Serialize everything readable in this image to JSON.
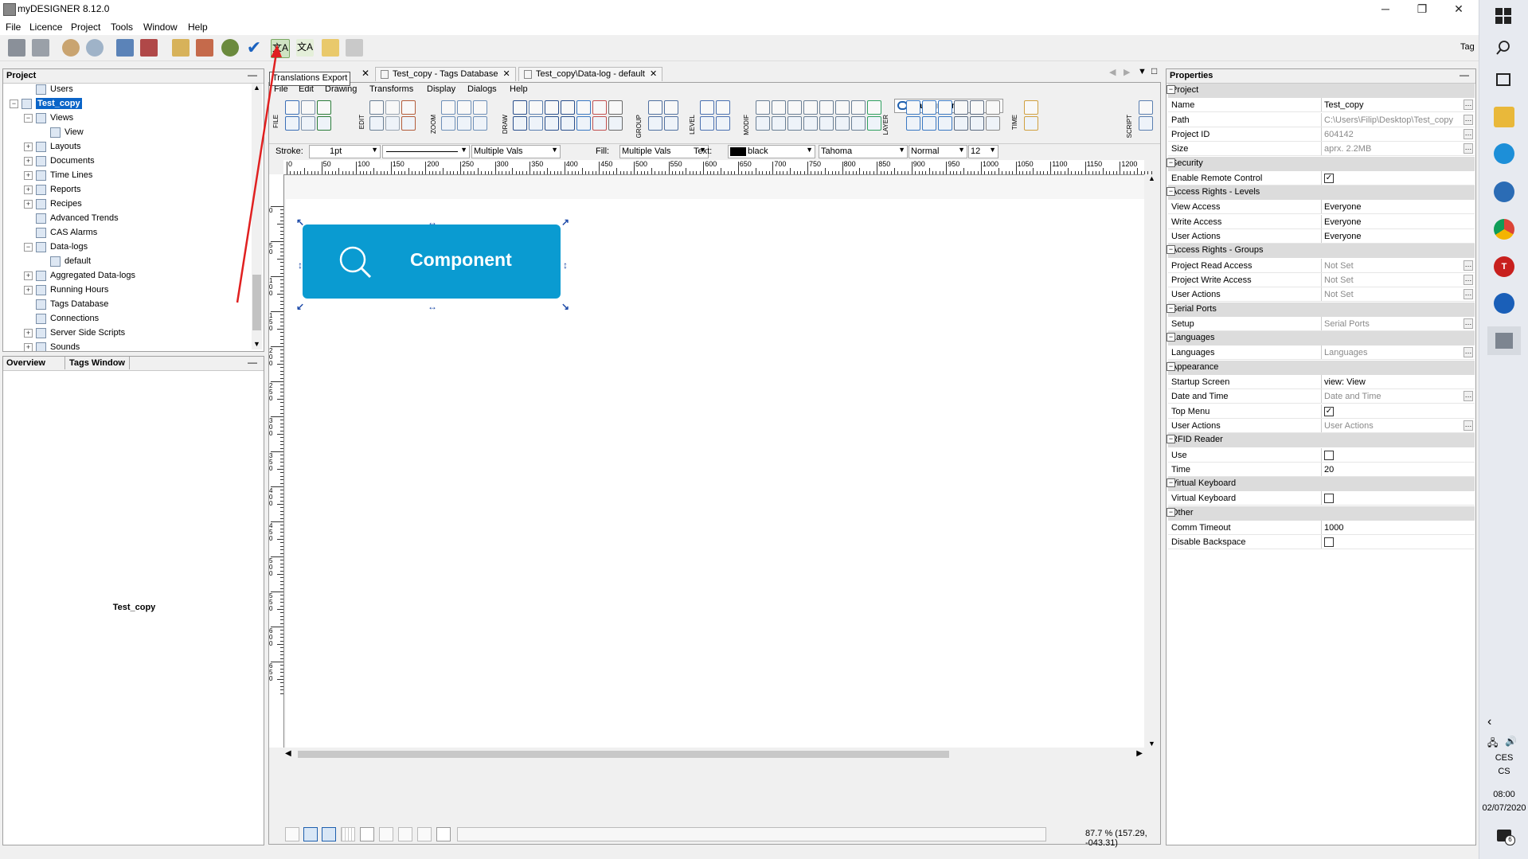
{
  "window": {
    "title": "myDESIGNER 8.12.0",
    "min": "─",
    "max": "❐",
    "close": "✕"
  },
  "menu": [
    "File",
    "Licence",
    "Project",
    "Tools",
    "Window",
    "Help"
  ],
  "toolbar": {
    "tag_label": "Tag",
    "tooltip": "Translations Export"
  },
  "project_panel": {
    "title": "Project",
    "items": [
      {
        "label": "Users",
        "indent": 1,
        "exp": ""
      },
      {
        "label": "Test_copy",
        "indent": 0,
        "exp": "−",
        "selected": true
      },
      {
        "label": "Views",
        "indent": 1,
        "exp": "−"
      },
      {
        "label": "View",
        "indent": 2,
        "exp": ""
      },
      {
        "label": "Layouts",
        "indent": 1,
        "exp": "+"
      },
      {
        "label": "Documents",
        "indent": 1,
        "exp": "+"
      },
      {
        "label": "Time Lines",
        "indent": 1,
        "exp": "+"
      },
      {
        "label": "Reports",
        "indent": 1,
        "exp": "+"
      },
      {
        "label": "Recipes",
        "indent": 1,
        "exp": "+"
      },
      {
        "label": "Advanced Trends",
        "indent": 1,
        "exp": ""
      },
      {
        "label": "CAS Alarms",
        "indent": 1,
        "exp": ""
      },
      {
        "label": "Data-logs",
        "indent": 1,
        "exp": "−"
      },
      {
        "label": "default",
        "indent": 2,
        "exp": ""
      },
      {
        "label": "Aggregated Data-logs",
        "indent": 1,
        "exp": "+"
      },
      {
        "label": "Running Hours",
        "indent": 1,
        "exp": "+"
      },
      {
        "label": "Tags Database",
        "indent": 1,
        "exp": ""
      },
      {
        "label": "Connections",
        "indent": 1,
        "exp": ""
      },
      {
        "label": "Server Side Scripts",
        "indent": 1,
        "exp": "+"
      },
      {
        "label": "Sounds",
        "indent": 1,
        "exp": "+"
      }
    ]
  },
  "overview_panel": {
    "tab1": "Overview",
    "tab2": "Tags Window",
    "center_label": "Test_copy"
  },
  "doc_tabs": [
    {
      "label": "Test_copy - Tags Database"
    },
    {
      "label": "Test_copy\\Data-log - default"
    }
  ],
  "editor_menu": [
    "File",
    "Edit",
    "Drawing",
    "Transforms",
    "Display",
    "Dialogs",
    "Help"
  ],
  "editor_groups": [
    "FILE",
    "EDIT",
    "ZOOM",
    "DRAW",
    "GROUP",
    "LEVEL",
    "MODIF",
    "LAYER",
    "TIME",
    "SCRIPT"
  ],
  "layer": {
    "label": "Background"
  },
  "format_bar": {
    "stroke_label": "Stroke:",
    "stroke_value": "1pt",
    "stroke_style": "Multiple Vals",
    "fill_label": "Fill:",
    "fill_value": "Multiple Vals",
    "text_label": "Text:",
    "text_color": "black",
    "font": "Tahoma",
    "weight": "Normal",
    "size": "12"
  },
  "ruler_labels": [
    "0",
    "50",
    "100",
    "150",
    "200",
    "250",
    "300",
    "350",
    "400",
    "450",
    "500",
    "550",
    "600",
    "650",
    "700",
    "750",
    "800",
    "850",
    "900",
    "950",
    "1000",
    "1050",
    "1100",
    "1150",
    "1200"
  ],
  "vruler_labels": [
    "0",
    "50",
    "100",
    "150",
    "200",
    "250",
    "300",
    "350",
    "400",
    "450",
    "500",
    "550",
    "600",
    "650"
  ],
  "canvas": {
    "component_label": "Component",
    "component_color": "#0a9bd1"
  },
  "status": {
    "zoom": "87.7 % (157.29, -043.31)"
  },
  "properties": {
    "title": "Properties",
    "rows": [
      {
        "cat": "Project"
      },
      {
        "name": "Name",
        "value": "Test_copy",
        "btn": true
      },
      {
        "name": "Path",
        "value": "C:\\Users\\Filip\\Desktop\\Test_copy",
        "gray": true,
        "btn": true
      },
      {
        "name": "Project ID",
        "value": "604142",
        "gray": true,
        "btn": true
      },
      {
        "name": "Size",
        "value": "aprx. 2.2MB",
        "gray": true,
        "btn": true
      },
      {
        "cat": "Security"
      },
      {
        "name": "Enable Remote Control",
        "check": true
      },
      {
        "cat": "Access Rights - Levels"
      },
      {
        "name": "View Access",
        "value": "Everyone"
      },
      {
        "name": "Write Access",
        "value": "Everyone"
      },
      {
        "name": "User Actions",
        "value": "Everyone"
      },
      {
        "cat": "Access Rights - Groups"
      },
      {
        "name": "Project Read Access",
        "value": "Not Set",
        "gray": true,
        "btn": true
      },
      {
        "name": "Project Write Access",
        "value": "Not Set",
        "gray": true,
        "btn": true
      },
      {
        "name": "User Actions",
        "value": "Not Set",
        "gray": true,
        "btn": true
      },
      {
        "cat": "Serial Ports"
      },
      {
        "name": "Setup",
        "value": "Serial Ports",
        "gray": true,
        "btn": true
      },
      {
        "cat": "Languages"
      },
      {
        "name": "Languages",
        "value": "Languages",
        "gray": true,
        "btn": true
      },
      {
        "cat": "Appearance"
      },
      {
        "name": "Startup Screen",
        "value": "view: View"
      },
      {
        "name": "Date and Time",
        "value": "Date and Time",
        "gray": true,
        "btn": true
      },
      {
        "name": "Top Menu",
        "check": true
      },
      {
        "name": "User Actions",
        "value": "User Actions",
        "gray": true,
        "btn": true
      },
      {
        "cat": "RFID Reader"
      },
      {
        "name": "Use",
        "check": false
      },
      {
        "name": "Time",
        "value": "20"
      },
      {
        "cat": "Virtual Keyboard"
      },
      {
        "name": "Virtual Keyboard",
        "check": false
      },
      {
        "cat": "Other"
      },
      {
        "name": "Comm Timeout",
        "value": "1000"
      },
      {
        "name": "Disable Backspace",
        "check": false
      }
    ]
  },
  "taskbar": {
    "lang1": "CES",
    "lang2": "CS",
    "time": "08:00",
    "date": "02/07/2020",
    "notif_count": "6"
  }
}
